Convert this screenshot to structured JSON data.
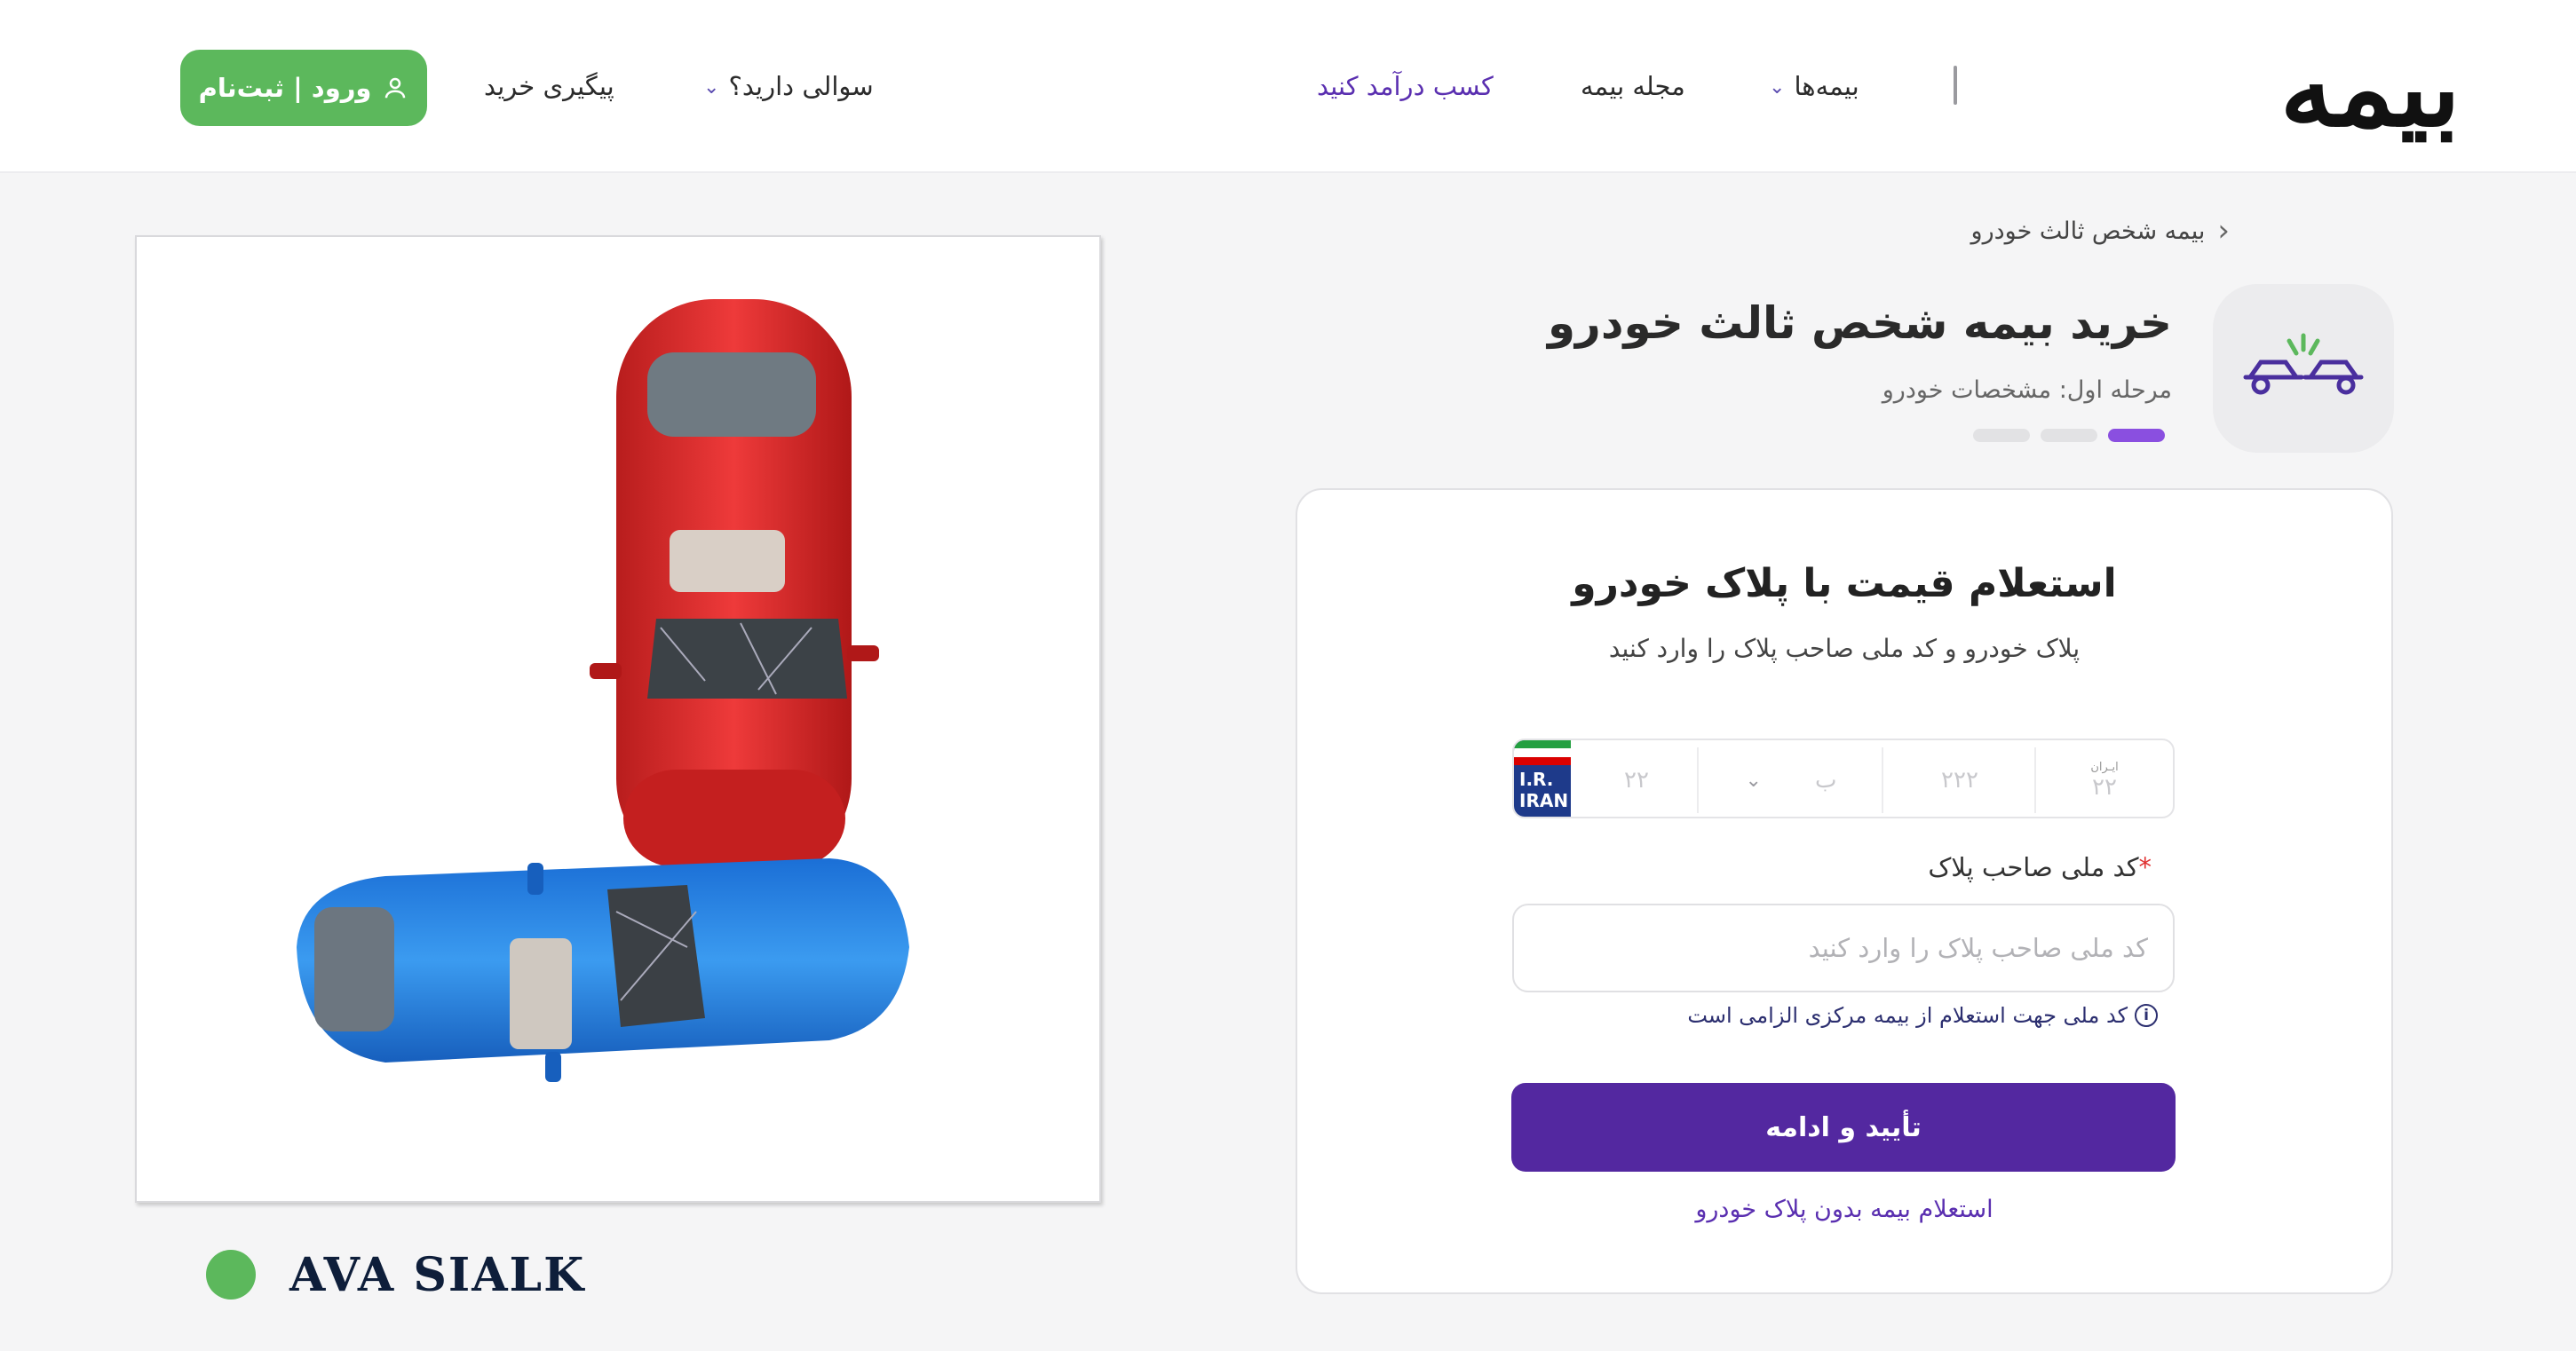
{
  "header": {
    "logo": "بیمه",
    "nav": {
      "insurances": "بیمه‌ها",
      "magazine": "مجله بیمه",
      "earn": "کسب درآمد کنید",
      "questions": "سوالی دارید؟",
      "tracking": "پیگیری خرید"
    },
    "login_label": "ورود | ثبت‌نام"
  },
  "breadcrumb": "بیمه شخص ثالث خودرو",
  "page": {
    "title": "خرید بیمه شخص ثالث خودرو",
    "step_label": "مرحله اول: مشخصات خودرو",
    "steps_total": 3,
    "steps_active": 1
  },
  "form": {
    "title": "استعلام قیمت با پلاک خودرو",
    "subtitle": "پلاک خودرو و کد ملی صاحب پلاک را وارد کنید",
    "plate": {
      "flag_code": "I.R. IRAN",
      "seg1": "۲۲",
      "seg2_letter": "ب",
      "seg3": "۲۲۲",
      "seg4_label": "ایـران",
      "seg4": "۲۲"
    },
    "national_id_label": "کد ملی صاحب پلاک",
    "national_id_required": "*",
    "national_id_placeholder": "کد ملی صاحب پلاک را وارد کنید",
    "hint": "کد ملی جهت استعلام از بیمه مرکزی الزامی است",
    "submit_label": "تأیید و ادامه",
    "alt_link": "استعلام بیمه بدون پلاک خودرو"
  },
  "brand": {
    "name": "AVA SIALK",
    "dot_color": "#5cb85c"
  },
  "colors": {
    "primary": "#5328a0",
    "accent": "#8a4fe0",
    "login": "#5cb85c"
  },
  "icons": {
    "product": "car-crash-icon",
    "user": "user-icon",
    "chevron": "chevron-down-icon",
    "info": "info-icon"
  }
}
